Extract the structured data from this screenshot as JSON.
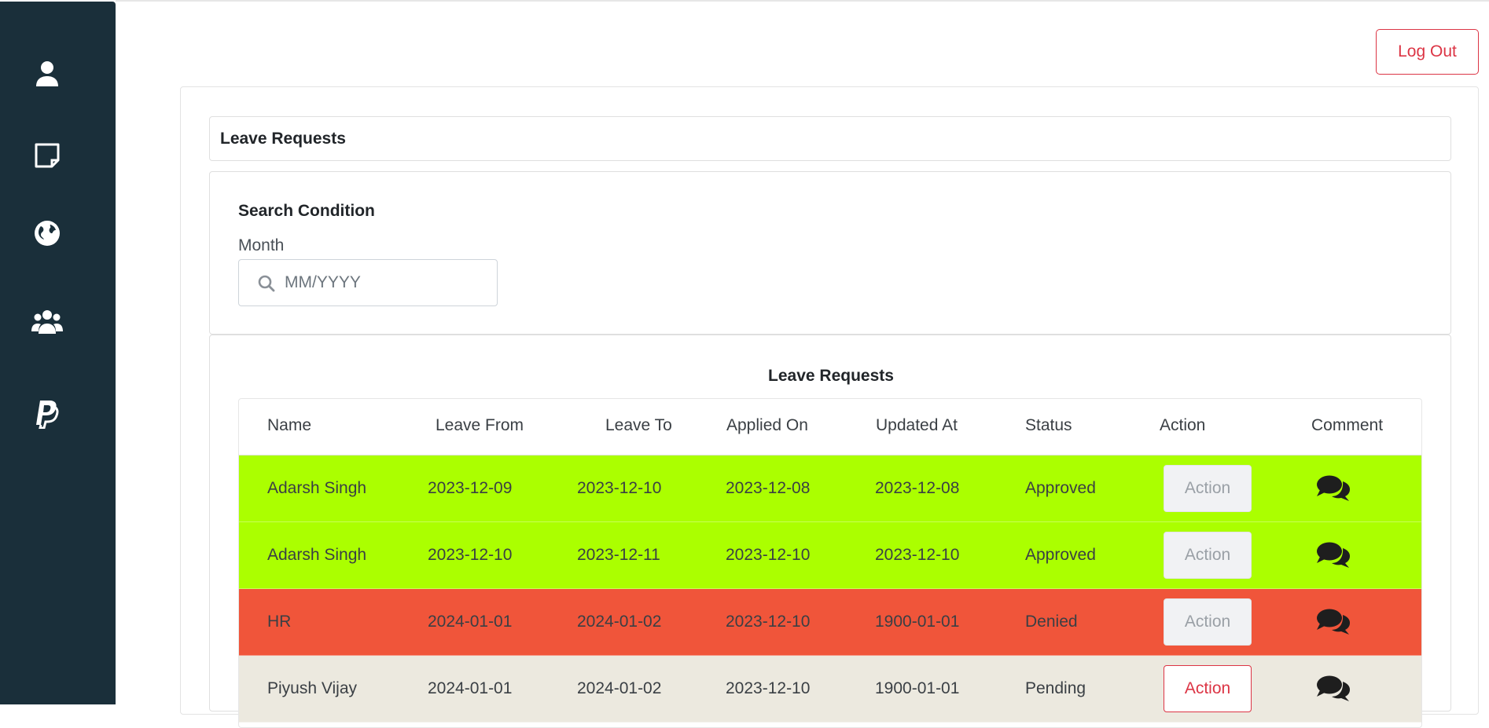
{
  "header": {
    "logout_label": "Log Out"
  },
  "page": {
    "title": "Leave Requests"
  },
  "search": {
    "title": "Search Condition",
    "month_label": "Month",
    "month_placeholder": "MM/YYYY",
    "month_value": ""
  },
  "sidebar": {
    "icons": [
      "user-icon",
      "sticky-note-icon",
      "globe-icon",
      "users-icon",
      "paypal-icon"
    ]
  },
  "table": {
    "title": "Leave Requests",
    "columns": [
      "Name",
      "Leave From",
      "Leave To",
      "Applied On",
      "Updated At",
      "Status",
      "Action",
      "Comment"
    ],
    "rows": [
      {
        "name": "Adarsh Singh",
        "leave_from": "2023-12-09",
        "leave_to": "2023-12-10",
        "applied_on": "2023-12-08",
        "updated_at": "2023-12-08",
        "status": "Approved",
        "action": "Action",
        "action_enabled": false,
        "row_color": "#abff00"
      },
      {
        "name": "Adarsh Singh",
        "leave_from": "2023-12-10",
        "leave_to": "2023-12-11",
        "applied_on": "2023-12-10",
        "updated_at": "2023-12-10",
        "status": "Approved",
        "action": "Action",
        "action_enabled": false,
        "row_color": "#abff00"
      },
      {
        "name": "HR",
        "leave_from": "2024-01-01",
        "leave_to": "2024-01-02",
        "applied_on": "2023-12-10",
        "updated_at": "1900-01-01",
        "status": "Denied",
        "action": "Action",
        "action_enabled": false,
        "row_color": "#f0553a"
      },
      {
        "name": "Piyush Vijay",
        "leave_from": "2024-01-01",
        "leave_to": "2024-01-02",
        "applied_on": "2023-12-10",
        "updated_at": "1900-01-01",
        "status": "Pending",
        "action": "Action",
        "action_enabled": true,
        "row_color": "#ece9df"
      }
    ]
  },
  "colors": {
    "sidebar": "#1a2f3a",
    "accent_red": "#dc3545"
  }
}
